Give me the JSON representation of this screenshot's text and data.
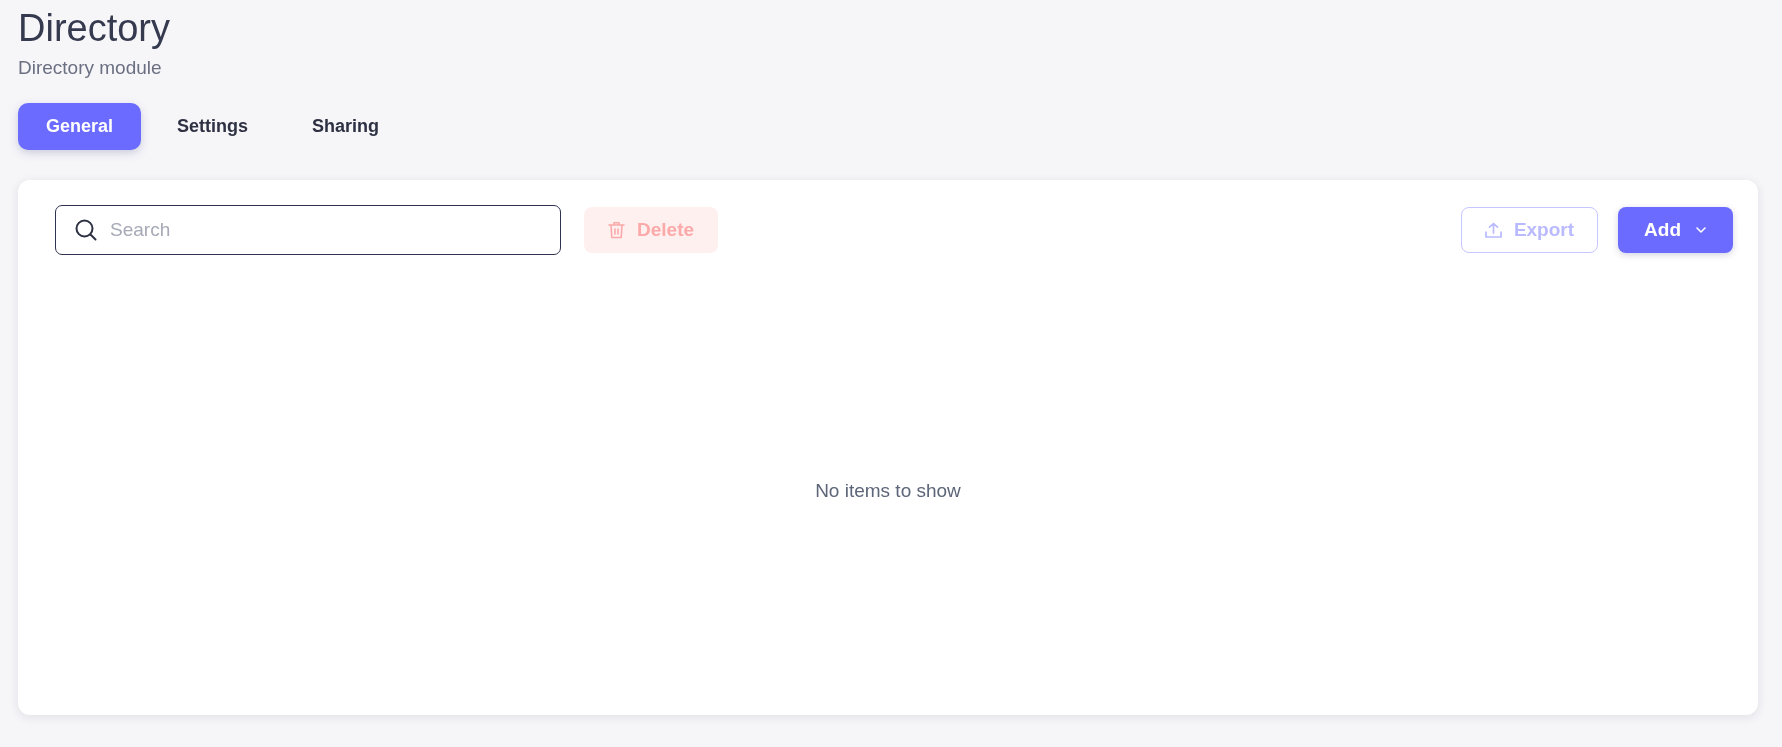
{
  "header": {
    "title": "Directory",
    "subtitle": "Directory module"
  },
  "tabs": [
    {
      "label": "General",
      "selected": true
    },
    {
      "label": "Settings",
      "selected": false
    },
    {
      "label": "Sharing",
      "selected": false
    }
  ],
  "toolbar": {
    "search": {
      "placeholder": "Search"
    },
    "left_actions": [
      {
        "label": "Delete",
        "kind": "delete",
        "disabled": true
      }
    ],
    "right_actions": [
      {
        "label": "Export",
        "kind": "export",
        "disabled": true
      },
      {
        "label": "Add",
        "kind": "add",
        "disabled": false,
        "dropdown": true
      }
    ]
  },
  "empty_state": {
    "message": "No items to show"
  }
}
